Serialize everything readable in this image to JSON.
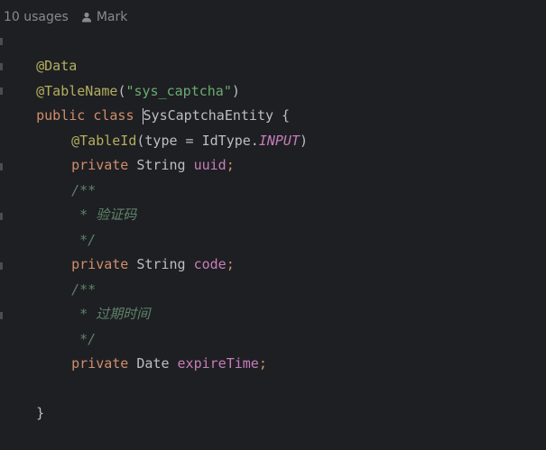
{
  "hints": {
    "usages": "10 usages",
    "author_icon": "person-icon",
    "author": "Mark"
  },
  "code": {
    "l1_annotation": "@Data",
    "l2_annotation": "@TableName",
    "l2_open": "(",
    "l2_string": "\"sys_captcha\"",
    "l2_close": ")",
    "l3_kw": "public class ",
    "l3_class": "SysCaptchaEntity",
    "l3_brace": " {",
    "l4_annotation": "@TableId",
    "l4_args": "(type = IdType.",
    "l4_enum": "INPUT",
    "l4_close": ")",
    "l5_kw": "private ",
    "l5_type": "String ",
    "l5_field": "uuid",
    "l5_semi": ";",
    "l6_comment": "/**",
    "l7_star": " * ",
    "l7_text": "验证码",
    "l8_comment": " */",
    "l9_kw": "private ",
    "l9_type": "String ",
    "l9_field": "code",
    "l9_semi": ";",
    "l10_comment": "/**",
    "l11_star": " * ",
    "l11_text": "过期时间",
    "l12_comment": " */",
    "l13_kw": "private ",
    "l13_type": "Date ",
    "l13_field": "expireTime",
    "l13_semi": ";",
    "l15_brace": "}"
  },
  "colors": {
    "background": "#1e1f22",
    "keyword": "#cf8e6d",
    "annotation": "#b3ae60",
    "string": "#6aab73",
    "field": "#c77dbb",
    "comment": "#5f826b",
    "text": "#bcbec4",
    "hint": "#868a91"
  }
}
